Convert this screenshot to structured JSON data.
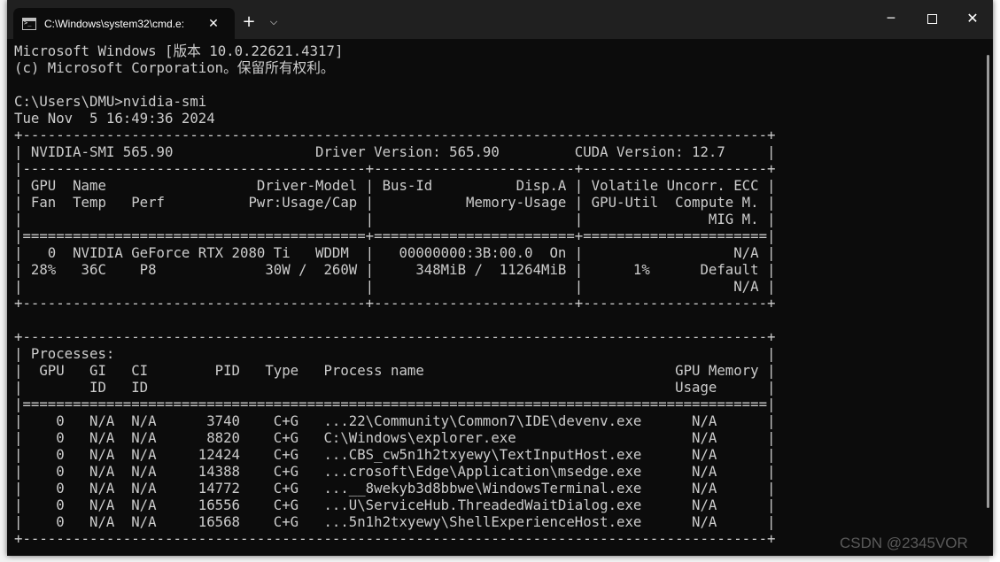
{
  "window": {
    "tab_title": "C:\\Windows\\system32\\cmd.e:",
    "tab_close": "✕",
    "new_tab": "+",
    "dropdown": "⌵",
    "minimize": "─",
    "close": "✕"
  },
  "terminal": {
    "lines": [
      "Microsoft Windows [版本 10.0.22621.4317]",
      "(c) Microsoft Corporation。保留所有权利。",
      "",
      "C:\\Users\\DMU>nvidia-smi",
      "Tue Nov  5 16:49:36 2024",
      "+-----------------------------------------------------------------------------------------+",
      "| NVIDIA-SMI 565.90                 Driver Version: 565.90         CUDA Version: 12.7     |",
      "|-----------------------------------------+------------------------+----------------------+",
      "| GPU  Name                  Driver-Model | Bus-Id          Disp.A | Volatile Uncorr. ECC |",
      "| Fan  Temp   Perf          Pwr:Usage/Cap |           Memory-Usage | GPU-Util  Compute M. |",
      "|                                         |                        |               MIG M. |",
      "|=========================================+========================+======================|",
      "|   0  NVIDIA GeForce RTX 2080 Ti   WDDM  |   00000000:3B:00.0  On |                  N/A |",
      "| 28%   36C    P8             30W /  260W |     348MiB /  11264MiB |      1%      Default |",
      "|                                         |                        |                  N/A |",
      "+-----------------------------------------+------------------------+----------------------+",
      "",
      "+-----------------------------------------------------------------------------------------+",
      "| Processes:                                                                              |",
      "|  GPU   GI   CI        PID   Type   Process name                              GPU Memory |",
      "|        ID   ID                                                               Usage      |",
      "|=========================================================================================|",
      "|    0   N/A  N/A      3740    C+G   ...22\\Community\\Common7\\IDE\\devenv.exe      N/A      |",
      "|    0   N/A  N/A      8820    C+G   C:\\Windows\\explorer.exe                     N/A      |",
      "|    0   N/A  N/A     12424    C+G   ...CBS_cw5n1h2txyewy\\TextInputHost.exe      N/A      |",
      "|    0   N/A  N/A     14388    C+G   ...crosoft\\Edge\\Application\\msedge.exe      N/A      |",
      "|    0   N/A  N/A     14772    C+G   ...__8wekyb3d8bbwe\\WindowsTerminal.exe      N/A      |",
      "|    0   N/A  N/A     16556    C+G   ...U\\ServiceHub.ThreadedWaitDialog.exe      N/A      |",
      "|    0   N/A  N/A     16568    C+G   ...5n1h2txyewy\\ShellExperienceHost.exe      N/A      |",
      "+-----------------------------------------------------------------------------------------+"
    ]
  },
  "watermark": "CSDN @2345VOR",
  "colors": {
    "terminal_bg": "#0c0c0c",
    "terminal_fg": "#cccccc",
    "titlebar_bg": "#202020"
  }
}
